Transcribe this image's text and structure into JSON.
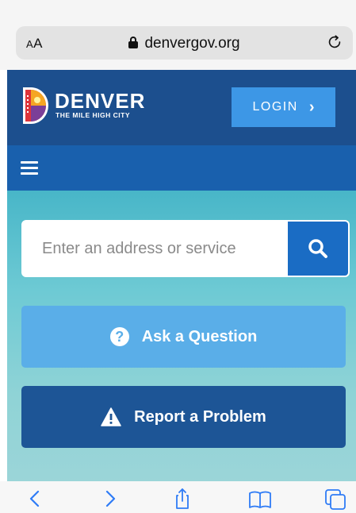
{
  "browser": {
    "text_size_label_small": "A",
    "text_size_label_large": "A",
    "url": "denvergov.org",
    "icons": {
      "lock": "lock-icon",
      "reload": "reload-icon"
    }
  },
  "header": {
    "brand_name": "DENVER",
    "brand_tagline": "THE MILE HIGH CITY",
    "login_label": "LOGIN",
    "login_chevron": "›",
    "brand_color": "#1c4f8e",
    "accent_color": "#3d97e6"
  },
  "nav": {
    "menu_icon": "hamburger-menu-icon",
    "bar_color": "#1960ad"
  },
  "hero": {
    "search": {
      "placeholder": "Enter an address or service",
      "value": ""
    },
    "ask_button_label": "Ask a Question",
    "ask_button_icon": "question-circle-icon",
    "report_button_label": "Report a Problem",
    "report_button_icon": "warning-triangle-icon",
    "ask_color": "#5aaee8",
    "report_color": "#1d5596"
  },
  "toolbar": {
    "items": [
      "back-icon",
      "forward-icon",
      "share-icon",
      "bookmarks-icon",
      "tabs-icon"
    ],
    "icon_color": "#2f7cf6"
  }
}
